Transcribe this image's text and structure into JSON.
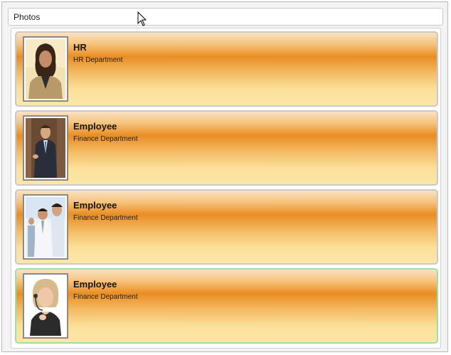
{
  "header": {
    "title": "Photos"
  },
  "cards": [
    {
      "name": "HR",
      "department": "HR Department",
      "photo": "woman-portrait-photo",
      "selected": false
    },
    {
      "name": "Employee",
      "department": "Finance Department",
      "photo": "man-suit-photo",
      "selected": false
    },
    {
      "name": "Employee",
      "department": "Finance Department",
      "photo": "office-group-photo",
      "selected": false
    },
    {
      "name": "Employee",
      "department": "Finance Department",
      "photo": "woman-headset-photo",
      "selected": true
    }
  ],
  "colors": {
    "card_gradient_mid": "#e98d23",
    "card_gradient_light": "#fbe7a8",
    "selected_border": "#9fe09f"
  },
  "cursor": "mouse-pointer-icon"
}
